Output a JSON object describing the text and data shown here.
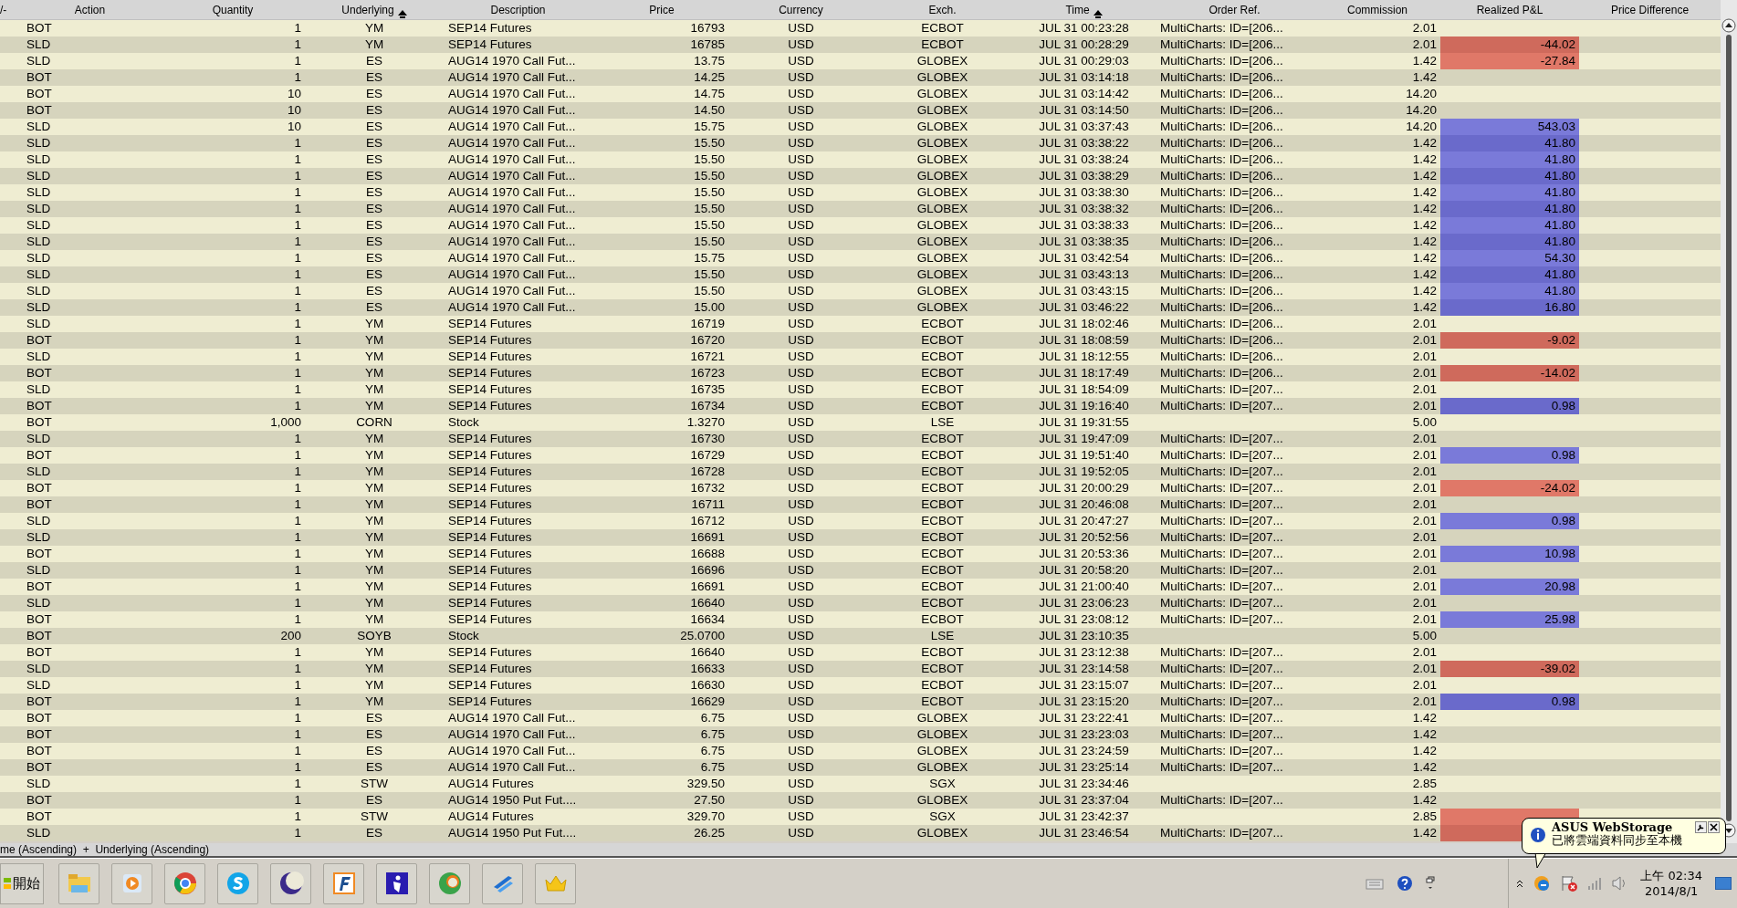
{
  "columns": [
    {
      "label": "/-",
      "sorted": false
    },
    {
      "label": "Action",
      "sorted": false
    },
    {
      "label": "Quantity",
      "sorted": false
    },
    {
      "label": "Underlying",
      "sorted": true
    },
    {
      "label": "Description",
      "sorted": false
    },
    {
      "label": "Price",
      "sorted": false
    },
    {
      "label": "Currency",
      "sorted": false
    },
    {
      "label": "Exch.",
      "sorted": false
    },
    {
      "label": "Time",
      "sorted": true
    },
    {
      "label": "Order Ref.",
      "sorted": false
    },
    {
      "label": "Commission",
      "sorted": false
    },
    {
      "label": "Realized P&L",
      "sorted": false
    },
    {
      "label": "Price Difference",
      "sorted": false
    }
  ],
  "rows": [
    {
      "action": "BOT",
      "quantity": "1",
      "underlying": "YM",
      "description": "SEP14 Futures",
      "price": "16793",
      "currency": "USD",
      "exch": "ECBOT",
      "time": "JUL 31 00:23:28",
      "order_ref": "MultiCharts: ID=[206...",
      "commission": "2.01"
    },
    {
      "action": "SLD",
      "quantity": "1",
      "underlying": "YM",
      "description": "SEP14 Futures",
      "price": "16785",
      "currency": "USD",
      "exch": "ECBOT",
      "time": "JUL 31 00:28:29",
      "order_ref": "MultiCharts: ID=[206...",
      "commission": "2.01",
      "pnl": "-44.02",
      "loss": true
    },
    {
      "action": "SLD",
      "quantity": "1",
      "underlying": "ES",
      "description": "AUG14 1970 Call Fut...",
      "price": "13.75",
      "currency": "USD",
      "exch": "GLOBEX",
      "time": "JUL 31 00:29:03",
      "order_ref": "MultiCharts: ID=[206...",
      "commission": "1.42",
      "pnl": "-27.84",
      "loss": true
    },
    {
      "action": "BOT",
      "quantity": "1",
      "underlying": "ES",
      "description": "AUG14 1970 Call Fut...",
      "price": "14.25",
      "currency": "USD",
      "exch": "GLOBEX",
      "time": "JUL 31 03:14:18",
      "order_ref": "MultiCharts: ID=[206...",
      "commission": "1.42"
    },
    {
      "action": "BOT",
      "quantity": "10",
      "underlying": "ES",
      "description": "AUG14 1970 Call Fut...",
      "price": "14.75",
      "currency": "USD",
      "exch": "GLOBEX",
      "time": "JUL 31 03:14:42",
      "order_ref": "MultiCharts: ID=[206...",
      "commission": "14.20"
    },
    {
      "action": "BOT",
      "quantity": "10",
      "underlying": "ES",
      "description": "AUG14 1970 Call Fut...",
      "price": "14.50",
      "currency": "USD",
      "exch": "GLOBEX",
      "time": "JUL 31 03:14:50",
      "order_ref": "MultiCharts: ID=[206...",
      "commission": "14.20"
    },
    {
      "action": "SLD",
      "quantity": "10",
      "underlying": "ES",
      "description": "AUG14 1970 Call Fut...",
      "price": "15.75",
      "currency": "USD",
      "exch": "GLOBEX",
      "time": "JUL 31 03:37:43",
      "order_ref": "MultiCharts: ID=[206...",
      "commission": "14.20",
      "pnl": "543.03",
      "loss": false
    },
    {
      "action": "SLD",
      "quantity": "1",
      "underlying": "ES",
      "description": "AUG14 1970 Call Fut...",
      "price": "15.50",
      "currency": "USD",
      "exch": "GLOBEX",
      "time": "JUL 31 03:38:22",
      "order_ref": "MultiCharts: ID=[206...",
      "commission": "1.42",
      "pnl": "41.80",
      "loss": false
    },
    {
      "action": "SLD",
      "quantity": "1",
      "underlying": "ES",
      "description": "AUG14 1970 Call Fut...",
      "price": "15.50",
      "currency": "USD",
      "exch": "GLOBEX",
      "time": "JUL 31 03:38:24",
      "order_ref": "MultiCharts: ID=[206...",
      "commission": "1.42",
      "pnl": "41.80",
      "loss": false
    },
    {
      "action": "SLD",
      "quantity": "1",
      "underlying": "ES",
      "description": "AUG14 1970 Call Fut...",
      "price": "15.50",
      "currency": "USD",
      "exch": "GLOBEX",
      "time": "JUL 31 03:38:29",
      "order_ref": "MultiCharts: ID=[206...",
      "commission": "1.42",
      "pnl": "41.80",
      "loss": false
    },
    {
      "action": "SLD",
      "quantity": "1",
      "underlying": "ES",
      "description": "AUG14 1970 Call Fut...",
      "price": "15.50",
      "currency": "USD",
      "exch": "GLOBEX",
      "time": "JUL 31 03:38:30",
      "order_ref": "MultiCharts: ID=[206...",
      "commission": "1.42",
      "pnl": "41.80",
      "loss": false
    },
    {
      "action": "SLD",
      "quantity": "1",
      "underlying": "ES",
      "description": "AUG14 1970 Call Fut...",
      "price": "15.50",
      "currency": "USD",
      "exch": "GLOBEX",
      "time": "JUL 31 03:38:32",
      "order_ref": "MultiCharts: ID=[206...",
      "commission": "1.42",
      "pnl": "41.80",
      "loss": false
    },
    {
      "action": "SLD",
      "quantity": "1",
      "underlying": "ES",
      "description": "AUG14 1970 Call Fut...",
      "price": "15.50",
      "currency": "USD",
      "exch": "GLOBEX",
      "time": "JUL 31 03:38:33",
      "order_ref": "MultiCharts: ID=[206...",
      "commission": "1.42",
      "pnl": "41.80",
      "loss": false
    },
    {
      "action": "SLD",
      "quantity": "1",
      "underlying": "ES",
      "description": "AUG14 1970 Call Fut...",
      "price": "15.50",
      "currency": "USD",
      "exch": "GLOBEX",
      "time": "JUL 31 03:38:35",
      "order_ref": "MultiCharts: ID=[206...",
      "commission": "1.42",
      "pnl": "41.80",
      "loss": false
    },
    {
      "action": "SLD",
      "quantity": "1",
      "underlying": "ES",
      "description": "AUG14 1970 Call Fut...",
      "price": "15.75",
      "currency": "USD",
      "exch": "GLOBEX",
      "time": "JUL 31 03:42:54",
      "order_ref": "MultiCharts: ID=[206...",
      "commission": "1.42",
      "pnl": "54.30",
      "loss": false
    },
    {
      "action": "SLD",
      "quantity": "1",
      "underlying": "ES",
      "description": "AUG14 1970 Call Fut...",
      "price": "15.50",
      "currency": "USD",
      "exch": "GLOBEX",
      "time": "JUL 31 03:43:13",
      "order_ref": "MultiCharts: ID=[206...",
      "commission": "1.42",
      "pnl": "41.80",
      "loss": false
    },
    {
      "action": "SLD",
      "quantity": "1",
      "underlying": "ES",
      "description": "AUG14 1970 Call Fut...",
      "price": "15.50",
      "currency": "USD",
      "exch": "GLOBEX",
      "time": "JUL 31 03:43:15",
      "order_ref": "MultiCharts: ID=[206...",
      "commission": "1.42",
      "pnl": "41.80",
      "loss": false
    },
    {
      "action": "SLD",
      "quantity": "1",
      "underlying": "ES",
      "description": "AUG14 1970 Call Fut...",
      "price": "15.00",
      "currency": "USD",
      "exch": "GLOBEX",
      "time": "JUL 31 03:46:22",
      "order_ref": "MultiCharts: ID=[206...",
      "commission": "1.42",
      "pnl": "16.80",
      "loss": false
    },
    {
      "action": "SLD",
      "quantity": "1",
      "underlying": "YM",
      "description": "SEP14 Futures",
      "price": "16719",
      "currency": "USD",
      "exch": "ECBOT",
      "time": "JUL 31 18:02:46",
      "order_ref": "MultiCharts: ID=[206...",
      "commission": "2.01"
    },
    {
      "action": "BOT",
      "quantity": "1",
      "underlying": "YM",
      "description": "SEP14 Futures",
      "price": "16720",
      "currency": "USD",
      "exch": "ECBOT",
      "time": "JUL 31 18:08:59",
      "order_ref": "MultiCharts: ID=[206...",
      "commission": "2.01",
      "pnl": "-9.02",
      "loss": true
    },
    {
      "action": "SLD",
      "quantity": "1",
      "underlying": "YM",
      "description": "SEP14 Futures",
      "price": "16721",
      "currency": "USD",
      "exch": "ECBOT",
      "time": "JUL 31 18:12:55",
      "order_ref": "MultiCharts: ID=[206...",
      "commission": "2.01"
    },
    {
      "action": "BOT",
      "quantity": "1",
      "underlying": "YM",
      "description": "SEP14 Futures",
      "price": "16723",
      "currency": "USD",
      "exch": "ECBOT",
      "time": "JUL 31 18:17:49",
      "order_ref": "MultiCharts: ID=[206...",
      "commission": "2.01",
      "pnl": "-14.02",
      "loss": true
    },
    {
      "action": "SLD",
      "quantity": "1",
      "underlying": "YM",
      "description": "SEP14 Futures",
      "price": "16735",
      "currency": "USD",
      "exch": "ECBOT",
      "time": "JUL 31 18:54:09",
      "order_ref": "MultiCharts: ID=[207...",
      "commission": "2.01"
    },
    {
      "action": "BOT",
      "quantity": "1",
      "underlying": "YM",
      "description": "SEP14 Futures",
      "price": "16734",
      "currency": "USD",
      "exch": "ECBOT",
      "time": "JUL 31 19:16:40",
      "order_ref": "MultiCharts: ID=[207...",
      "commission": "2.01",
      "pnl": "0.98",
      "loss": false
    },
    {
      "action": "BOT",
      "quantity": "1,000",
      "underlying": "CORN",
      "description": "Stock",
      "price": "1.3270",
      "currency": "USD",
      "exch": "LSE",
      "time": "JUL 31 19:31:55",
      "commission": "5.00"
    },
    {
      "action": "SLD",
      "quantity": "1",
      "underlying": "YM",
      "description": "SEP14 Futures",
      "price": "16730",
      "currency": "USD",
      "exch": "ECBOT",
      "time": "JUL 31 19:47:09",
      "order_ref": "MultiCharts: ID=[207...",
      "commission": "2.01"
    },
    {
      "action": "BOT",
      "quantity": "1",
      "underlying": "YM",
      "description": "SEP14 Futures",
      "price": "16729",
      "currency": "USD",
      "exch": "ECBOT",
      "time": "JUL 31 19:51:40",
      "order_ref": "MultiCharts: ID=[207...",
      "commission": "2.01",
      "pnl": "0.98",
      "loss": false
    },
    {
      "action": "SLD",
      "quantity": "1",
      "underlying": "YM",
      "description": "SEP14 Futures",
      "price": "16728",
      "currency": "USD",
      "exch": "ECBOT",
      "time": "JUL 31 19:52:05",
      "order_ref": "MultiCharts: ID=[207...",
      "commission": "2.01"
    },
    {
      "action": "BOT",
      "quantity": "1",
      "underlying": "YM",
      "description": "SEP14 Futures",
      "price": "16732",
      "currency": "USD",
      "exch": "ECBOT",
      "time": "JUL 31 20:00:29",
      "order_ref": "MultiCharts: ID=[207...",
      "commission": "2.01",
      "pnl": "-24.02",
      "loss": true
    },
    {
      "action": "BOT",
      "quantity": "1",
      "underlying": "YM",
      "description": "SEP14 Futures",
      "price": "16711",
      "currency": "USD",
      "exch": "ECBOT",
      "time": "JUL 31 20:46:08",
      "order_ref": "MultiCharts: ID=[207...",
      "commission": "2.01"
    },
    {
      "action": "SLD",
      "quantity": "1",
      "underlying": "YM",
      "description": "SEP14 Futures",
      "price": "16712",
      "currency": "USD",
      "exch": "ECBOT",
      "time": "JUL 31 20:47:27",
      "order_ref": "MultiCharts: ID=[207...",
      "commission": "2.01",
      "pnl": "0.98",
      "loss": false
    },
    {
      "action": "SLD",
      "quantity": "1",
      "underlying": "YM",
      "description": "SEP14 Futures",
      "price": "16691",
      "currency": "USD",
      "exch": "ECBOT",
      "time": "JUL 31 20:52:56",
      "order_ref": "MultiCharts: ID=[207...",
      "commission": "2.01"
    },
    {
      "action": "BOT",
      "quantity": "1",
      "underlying": "YM",
      "description": "SEP14 Futures",
      "price": "16688",
      "currency": "USD",
      "exch": "ECBOT",
      "time": "JUL 31 20:53:36",
      "order_ref": "MultiCharts: ID=[207...",
      "commission": "2.01",
      "pnl": "10.98",
      "loss": false
    },
    {
      "action": "SLD",
      "quantity": "1",
      "underlying": "YM",
      "description": "SEP14 Futures",
      "price": "16696",
      "currency": "USD",
      "exch": "ECBOT",
      "time": "JUL 31 20:58:20",
      "order_ref": "MultiCharts: ID=[207...",
      "commission": "2.01"
    },
    {
      "action": "BOT",
      "quantity": "1",
      "underlying": "YM",
      "description": "SEP14 Futures",
      "price": "16691",
      "currency": "USD",
      "exch": "ECBOT",
      "time": "JUL 31 21:00:40",
      "order_ref": "MultiCharts: ID=[207...",
      "commission": "2.01",
      "pnl": "20.98",
      "loss": false
    },
    {
      "action": "SLD",
      "quantity": "1",
      "underlying": "YM",
      "description": "SEP14 Futures",
      "price": "16640",
      "currency": "USD",
      "exch": "ECBOT",
      "time": "JUL 31 23:06:23",
      "order_ref": "MultiCharts: ID=[207...",
      "commission": "2.01"
    },
    {
      "action": "BOT",
      "quantity": "1",
      "underlying": "YM",
      "description": "SEP14 Futures",
      "price": "16634",
      "currency": "USD",
      "exch": "ECBOT",
      "time": "JUL 31 23:08:12",
      "order_ref": "MultiCharts: ID=[207...",
      "commission": "2.01",
      "pnl": "25.98",
      "loss": false
    },
    {
      "action": "BOT",
      "quantity": "200",
      "underlying": "SOYB",
      "description": "Stock",
      "price": "25.0700",
      "currency": "USD",
      "exch": "LSE",
      "time": "JUL 31 23:10:35",
      "commission": "5.00"
    },
    {
      "action": "BOT",
      "quantity": "1",
      "underlying": "YM",
      "description": "SEP14 Futures",
      "price": "16640",
      "currency": "USD",
      "exch": "ECBOT",
      "time": "JUL 31 23:12:38",
      "order_ref": "MultiCharts: ID=[207...",
      "commission": "2.01"
    },
    {
      "action": "SLD",
      "quantity": "1",
      "underlying": "YM",
      "description": "SEP14 Futures",
      "price": "16633",
      "currency": "USD",
      "exch": "ECBOT",
      "time": "JUL 31 23:14:58",
      "order_ref": "MultiCharts: ID=[207...",
      "commission": "2.01",
      "pnl": "-39.02",
      "loss": true
    },
    {
      "action": "SLD",
      "quantity": "1",
      "underlying": "YM",
      "description": "SEP14 Futures",
      "price": "16630",
      "currency": "USD",
      "exch": "ECBOT",
      "time": "JUL 31 23:15:07",
      "order_ref": "MultiCharts: ID=[207...",
      "commission": "2.01"
    },
    {
      "action": "BOT",
      "quantity": "1",
      "underlying": "YM",
      "description": "SEP14 Futures",
      "price": "16629",
      "currency": "USD",
      "exch": "ECBOT",
      "time": "JUL 31 23:15:20",
      "order_ref": "MultiCharts: ID=[207...",
      "commission": "2.01",
      "pnl": "0.98",
      "loss": false
    },
    {
      "action": "BOT",
      "quantity": "1",
      "underlying": "ES",
      "description": "AUG14 1970 Call Fut...",
      "price": "6.75",
      "currency": "USD",
      "exch": "GLOBEX",
      "time": "JUL 31 23:22:41",
      "order_ref": "MultiCharts: ID=[207...",
      "commission": "1.42"
    },
    {
      "action": "BOT",
      "quantity": "1",
      "underlying": "ES",
      "description": "AUG14 1970 Call Fut...",
      "price": "6.75",
      "currency": "USD",
      "exch": "GLOBEX",
      "time": "JUL 31 23:23:03",
      "order_ref": "MultiCharts: ID=[207...",
      "commission": "1.42"
    },
    {
      "action": "BOT",
      "quantity": "1",
      "underlying": "ES",
      "description": "AUG14 1970 Call Fut...",
      "price": "6.75",
      "currency": "USD",
      "exch": "GLOBEX",
      "time": "JUL 31 23:24:59",
      "order_ref": "MultiCharts: ID=[207...",
      "commission": "1.42"
    },
    {
      "action": "BOT",
      "quantity": "1",
      "underlying": "ES",
      "description": "AUG14 1970 Call Fut...",
      "price": "6.75",
      "currency": "USD",
      "exch": "GLOBEX",
      "time": "JUL 31 23:25:14",
      "order_ref": "MultiCharts: ID=[207...",
      "commission": "1.42"
    },
    {
      "action": "SLD",
      "quantity": "1",
      "underlying": "STW",
      "description": "AUG14 Futures",
      "price": "329.50",
      "currency": "USD",
      "exch": "SGX",
      "time": "JUL 31 23:34:46",
      "commission": "2.85"
    },
    {
      "action": "BOT",
      "quantity": "1",
      "underlying": "ES",
      "description": "AUG14 1950 Put Fut....",
      "price": "27.50",
      "currency": "USD",
      "exch": "GLOBEX",
      "time": "JUL 31 23:37:04",
      "order_ref": "MultiCharts: ID=[207...",
      "commission": "1.42"
    },
    {
      "action": "BOT",
      "quantity": "1",
      "underlying": "STW",
      "description": "AUG14 Futures",
      "price": "329.70",
      "currency": "USD",
      "exch": "SGX",
      "time": "JUL 31 23:42:37",
      "commission": "2.85",
      "loss": true
    },
    {
      "action": "SLD",
      "quantity": "1",
      "underlying": "ES",
      "description": "AUG14 1950 Put Fut....",
      "price": "26.25",
      "currency": "USD",
      "exch": "GLOBEX",
      "time": "JUL 31 23:46:54",
      "order_ref": "MultiCharts: ID=[207...",
      "commission": "1.42",
      "loss": true
    }
  ],
  "status_bar": "me (Ascending)  +  Underlying (Ascending)",
  "taskbar": {
    "start": "開始"
  },
  "tray": {
    "time": "上午 02:34",
    "date": "2014/8/1"
  },
  "notification": {
    "title": "ASUS WebStorage",
    "message": "已將雲端資料同步至本機"
  }
}
